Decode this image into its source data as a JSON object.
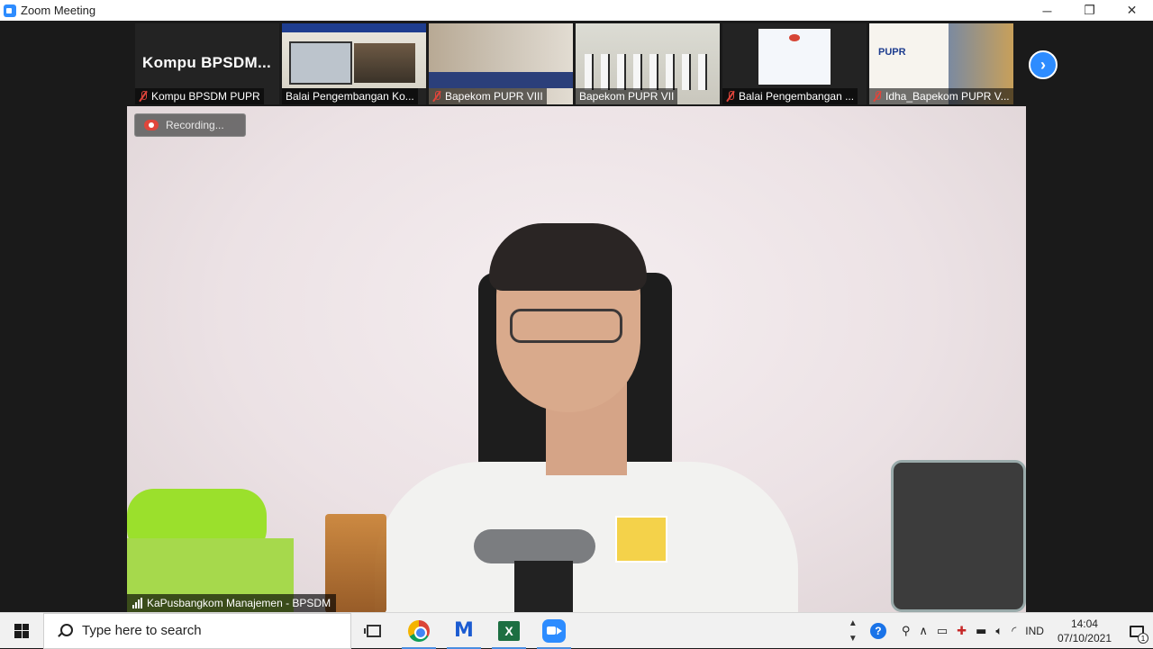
{
  "window": {
    "title": "Zoom Meeting",
    "controls": {
      "minimize": "─",
      "maximize": "❐",
      "close": "✕"
    }
  },
  "gallery": {
    "next_icon": "chevron-right-icon",
    "tiles": [
      {
        "display_text": "Kompu  BPSDM...",
        "name": "Kompu BPSDM PUPR",
        "muted": true
      },
      {
        "name": "Balai Pengembangan Ko...",
        "muted": false
      },
      {
        "name": "Bapekom PUPR VIII",
        "muted": true
      },
      {
        "name": "Bapekom PUPR VII",
        "muted": false
      },
      {
        "name": "Balai Pengembangan ...",
        "muted": true
      },
      {
        "name": "Idha_Bapekom PUPR V...",
        "muted": true
      }
    ],
    "thumb_labels": {
      "slide_brand": "PUPR"
    }
  },
  "main_video": {
    "recording_label": "Recording...",
    "speaker_name": "KaPusbangkom Manajemen - BPSDM"
  },
  "taskbar": {
    "search_placeholder": "Type here to search",
    "excel_glyph": "X",
    "tray": {
      "up_arrow": "∧",
      "language": "IND",
      "time": "14:04",
      "date": "07/10/2021",
      "notification_count": "1"
    }
  },
  "colors": {
    "zoom_blue": "#2D8CFF",
    "muted_red": "#e0453b",
    "meeting_bg": "#1a1a1a"
  }
}
